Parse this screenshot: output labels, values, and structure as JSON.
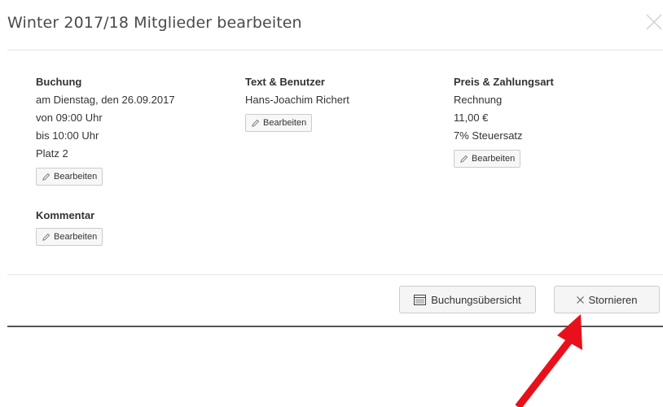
{
  "modal": {
    "title": "Winter 2017/18 Mitglieder bearbeiten"
  },
  "buchung": {
    "heading": "Buchung",
    "lines": [
      "am Dienstag, den 26.09.2017",
      "von 09:00 Uhr",
      "bis 10:00 Uhr",
      "Platz 2"
    ],
    "edit_label": "Bearbeiten"
  },
  "kommentar": {
    "heading": "Kommentar",
    "edit_label": "Bearbeiten"
  },
  "text_benutzer": {
    "heading": "Text & Benutzer",
    "lines": [
      "Hans-Joachim Richert"
    ],
    "edit_label": "Bearbeiten"
  },
  "preis": {
    "heading": "Preis & Zahlungsart",
    "lines": [
      "Rechnung",
      "11,00 €",
      "7% Steuersatz"
    ],
    "edit_label": "Bearbeiten"
  },
  "footer": {
    "overview_label": "Buchungsübersicht",
    "cancel_label": "Stornieren"
  },
  "colors": {
    "annotation_arrow": "#e8101a"
  }
}
